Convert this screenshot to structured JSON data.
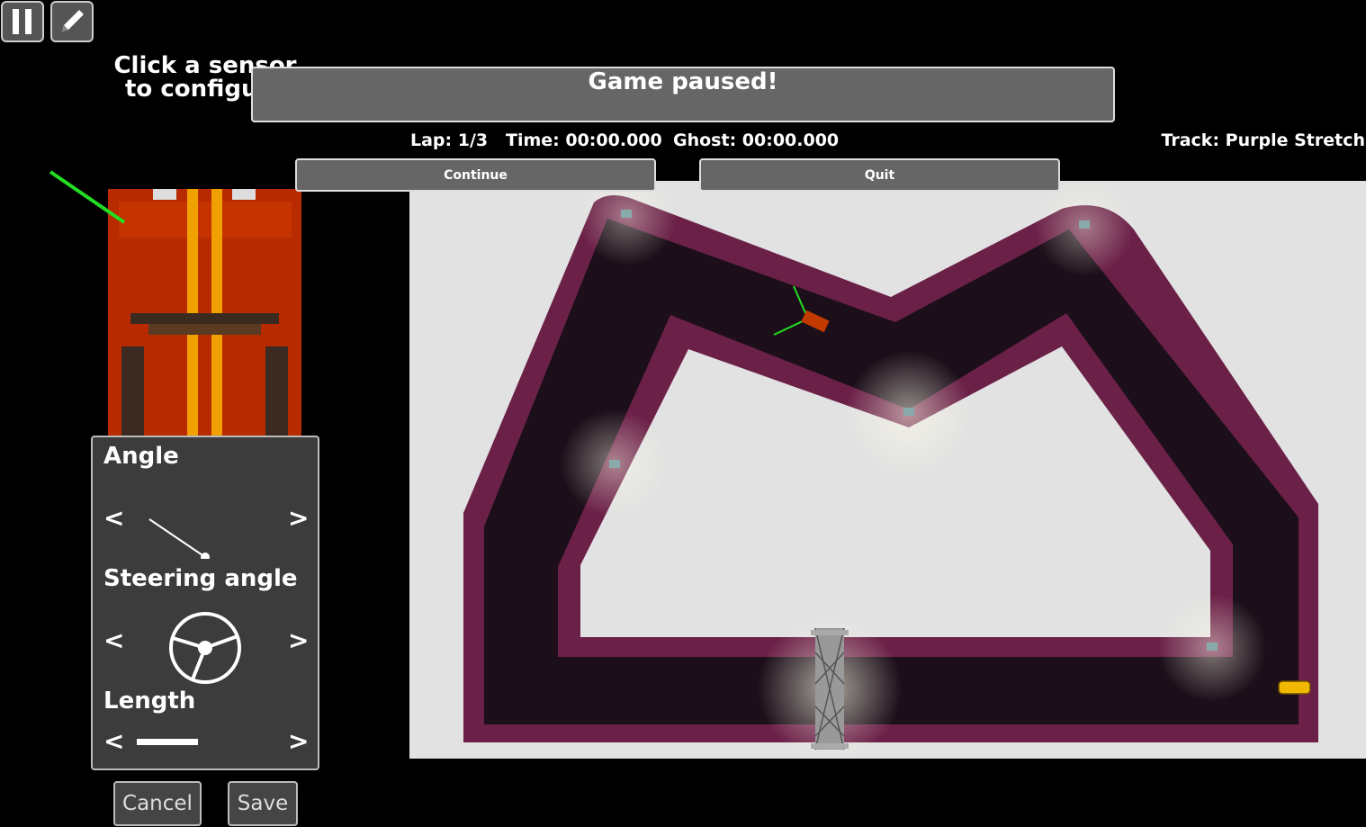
{
  "toolbar": {
    "pause_icon": "pause-icon",
    "edit_icon": "pencil-icon"
  },
  "hint": {
    "line1": "Click a sensor",
    "line2": "to configure"
  },
  "sensor_panel": {
    "angle_label": "Angle",
    "steering_label": "Steering angle",
    "length_label": "Length",
    "prev_symbol": "<",
    "next_symbol": ">"
  },
  "actions": {
    "cancel": "Cancel",
    "save": "Save"
  },
  "hud": {
    "lap": "Lap: 1/3",
    "time": "Time: 00:00.000",
    "ghost": "Ghost: 00:00.000",
    "track": "Track: Purple Stretch"
  },
  "pause_modal": {
    "title": "Game paused!",
    "continue": "Continue",
    "quit": "Quit"
  },
  "colors": {
    "track_border": "#6b2048",
    "track_surface": "#1c0f1a",
    "infield": "#e2e2e2",
    "sensor": "#22dd22",
    "player_car": "#c23a00",
    "ghost_car": "#f0b800"
  }
}
